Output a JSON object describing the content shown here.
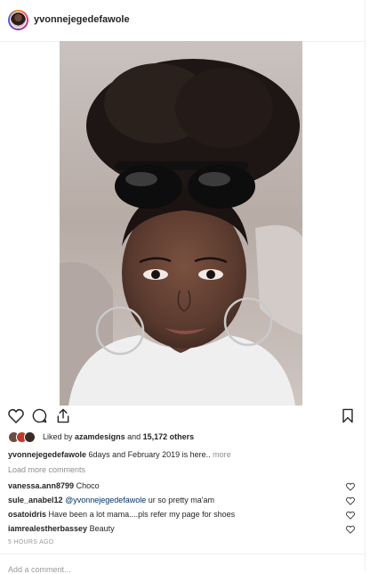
{
  "post": {
    "username": "yvonnejegedefawole",
    "likes": {
      "prefix": "Liked by",
      "liker": "azamdesigns",
      "joiner": "and",
      "others": "15,172 others"
    },
    "caption": {
      "username": "yvonnejegedefawole",
      "text": "6days and February 2019 is here..",
      "more": "more"
    },
    "load_more": "Load more comments",
    "comments": [
      {
        "user": "vanessa.ann8799",
        "mention": "",
        "text": "Choco"
      },
      {
        "user": "sule_anabel12",
        "mention": "@yvonnejegedefawole",
        "text": "ur so pretty ma'am"
      },
      {
        "user": "osatoidris",
        "mention": "",
        "text": "Have been a lot mama....pls refer my page for shoes"
      },
      {
        "user": "iamrealestherbassey",
        "mention": "",
        "text": "Beauty"
      }
    ],
    "timestamp": "5 HOURS AGO",
    "add_comment_placeholder": "Add a comment..."
  },
  "icons": {
    "like": "heart-icon",
    "comment": "comment-bubble-icon",
    "share": "share-icon",
    "save": "bookmark-icon",
    "comment_like": "small-heart-icon"
  },
  "colors": {
    "text": "#262626",
    "muted": "#8e8e8e",
    "mention": "#003569",
    "border": "#efefef"
  }
}
